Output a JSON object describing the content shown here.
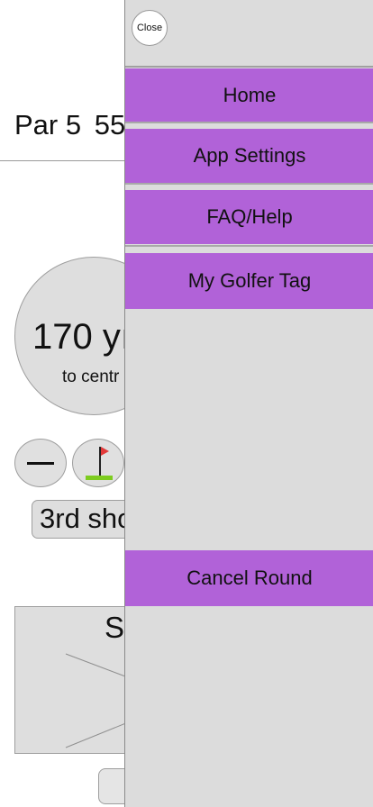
{
  "background": {
    "par_label": "Par 5",
    "yardage_partial": "55",
    "distance_value": "170 yı",
    "distance_sub": "to centr",
    "shot_label": "3rd sho",
    "stats_title": "S"
  },
  "drawer": {
    "close_label": "Close",
    "menu": {
      "home": "Home",
      "settings": "App Settings",
      "faq": "FAQ/Help",
      "golfer_tag": "My Golfer Tag"
    },
    "cancel_label": "Cancel Round"
  },
  "colors": {
    "menu_purple": "#b162d8",
    "drawer_bg": "#dcdcdc",
    "flag_red": "#e23a3a",
    "green": "#7dcc1f"
  },
  "icons": [
    "minus-icon",
    "flag-icon"
  ]
}
